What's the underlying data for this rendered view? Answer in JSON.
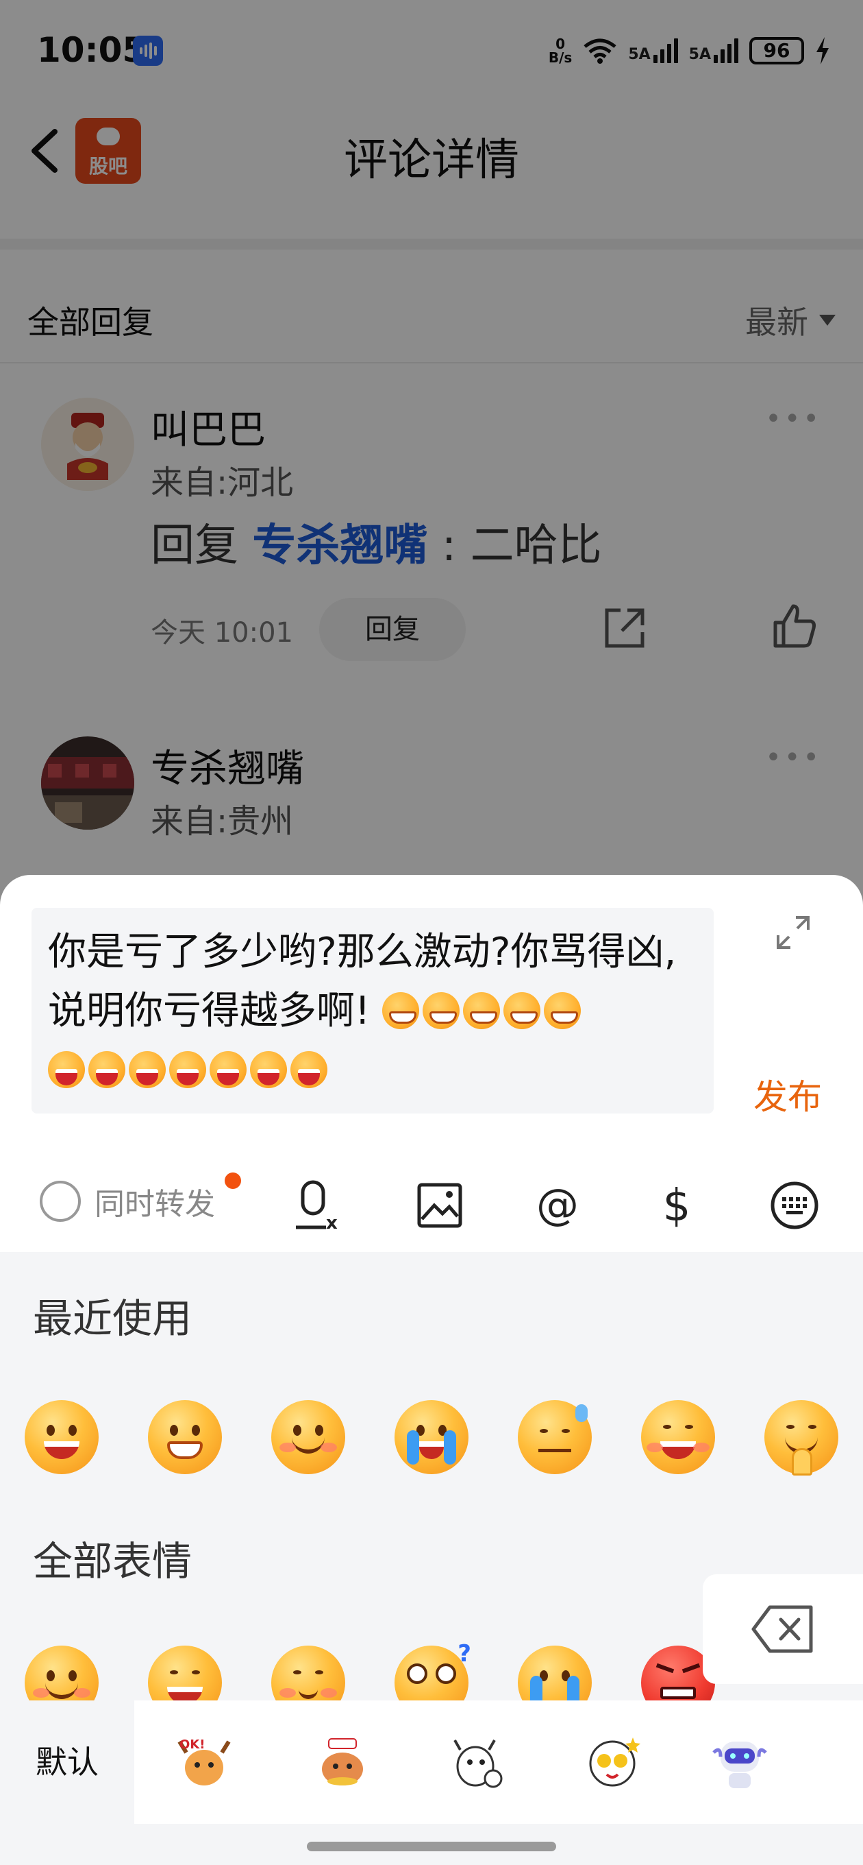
{
  "status_bar": {
    "time": "10:05",
    "net_speed_value": "0",
    "net_speed_unit": "B/s",
    "signal1_label": "5A",
    "signal2_label": "5A",
    "battery": "96"
  },
  "nav": {
    "back_icon": "chevron-left-icon",
    "app_logo_text": "股吧",
    "title": "评论详情"
  },
  "replies_header": {
    "title": "全部回复",
    "sort_label": "最新"
  },
  "comments": [
    {
      "name": "叫巴巴",
      "location": "来自:河北",
      "reply_prefix": "回复",
      "mention": "专杀翘嘴",
      "separator": ":",
      "content": "二哈比",
      "time": "今天 10:01",
      "reply_button": "回复"
    },
    {
      "name": "专杀翘嘴",
      "location": "来自:贵州"
    }
  ],
  "composer": {
    "text": "你是亏了多少哟?那么激动?你骂得凶,说明你亏得越多啊!",
    "trailing_emojis": [
      "grin",
      "grin",
      "grin",
      "grin",
      "grin",
      "laugh",
      "laugh",
      "laugh",
      "laugh",
      "laugh",
      "laugh",
      "laugh"
    ],
    "publish_label": "发布"
  },
  "toolbar": {
    "repost_label": "同时转发",
    "icons": [
      "voice-to-text-icon",
      "image-icon",
      "at-icon",
      "dollar-icon",
      "keyboard-icon"
    ]
  },
  "emoji_panel": {
    "recent_title": "最近使用",
    "all_title": "全部表情",
    "recent": [
      "laughing",
      "grinning",
      "smiling",
      "crying",
      "sweat-smirk",
      "happy-tongue",
      "praying-smile"
    ],
    "all": [
      "smiling",
      "laughing",
      "shy-smile",
      "dizzy",
      "crying",
      "angry"
    ]
  },
  "pack_bar": {
    "default_label": "默认",
    "packs": [
      "ok-bull-sticker-icon",
      "bull-coin-sticker-icon",
      "cow-sticker-icon",
      "star-eye-sticker-icon",
      "robot-sticker-icon"
    ]
  },
  "colors": {
    "accent": "#e8640d",
    "mention": "#1e5bd8",
    "logo": "#e84a1d"
  }
}
